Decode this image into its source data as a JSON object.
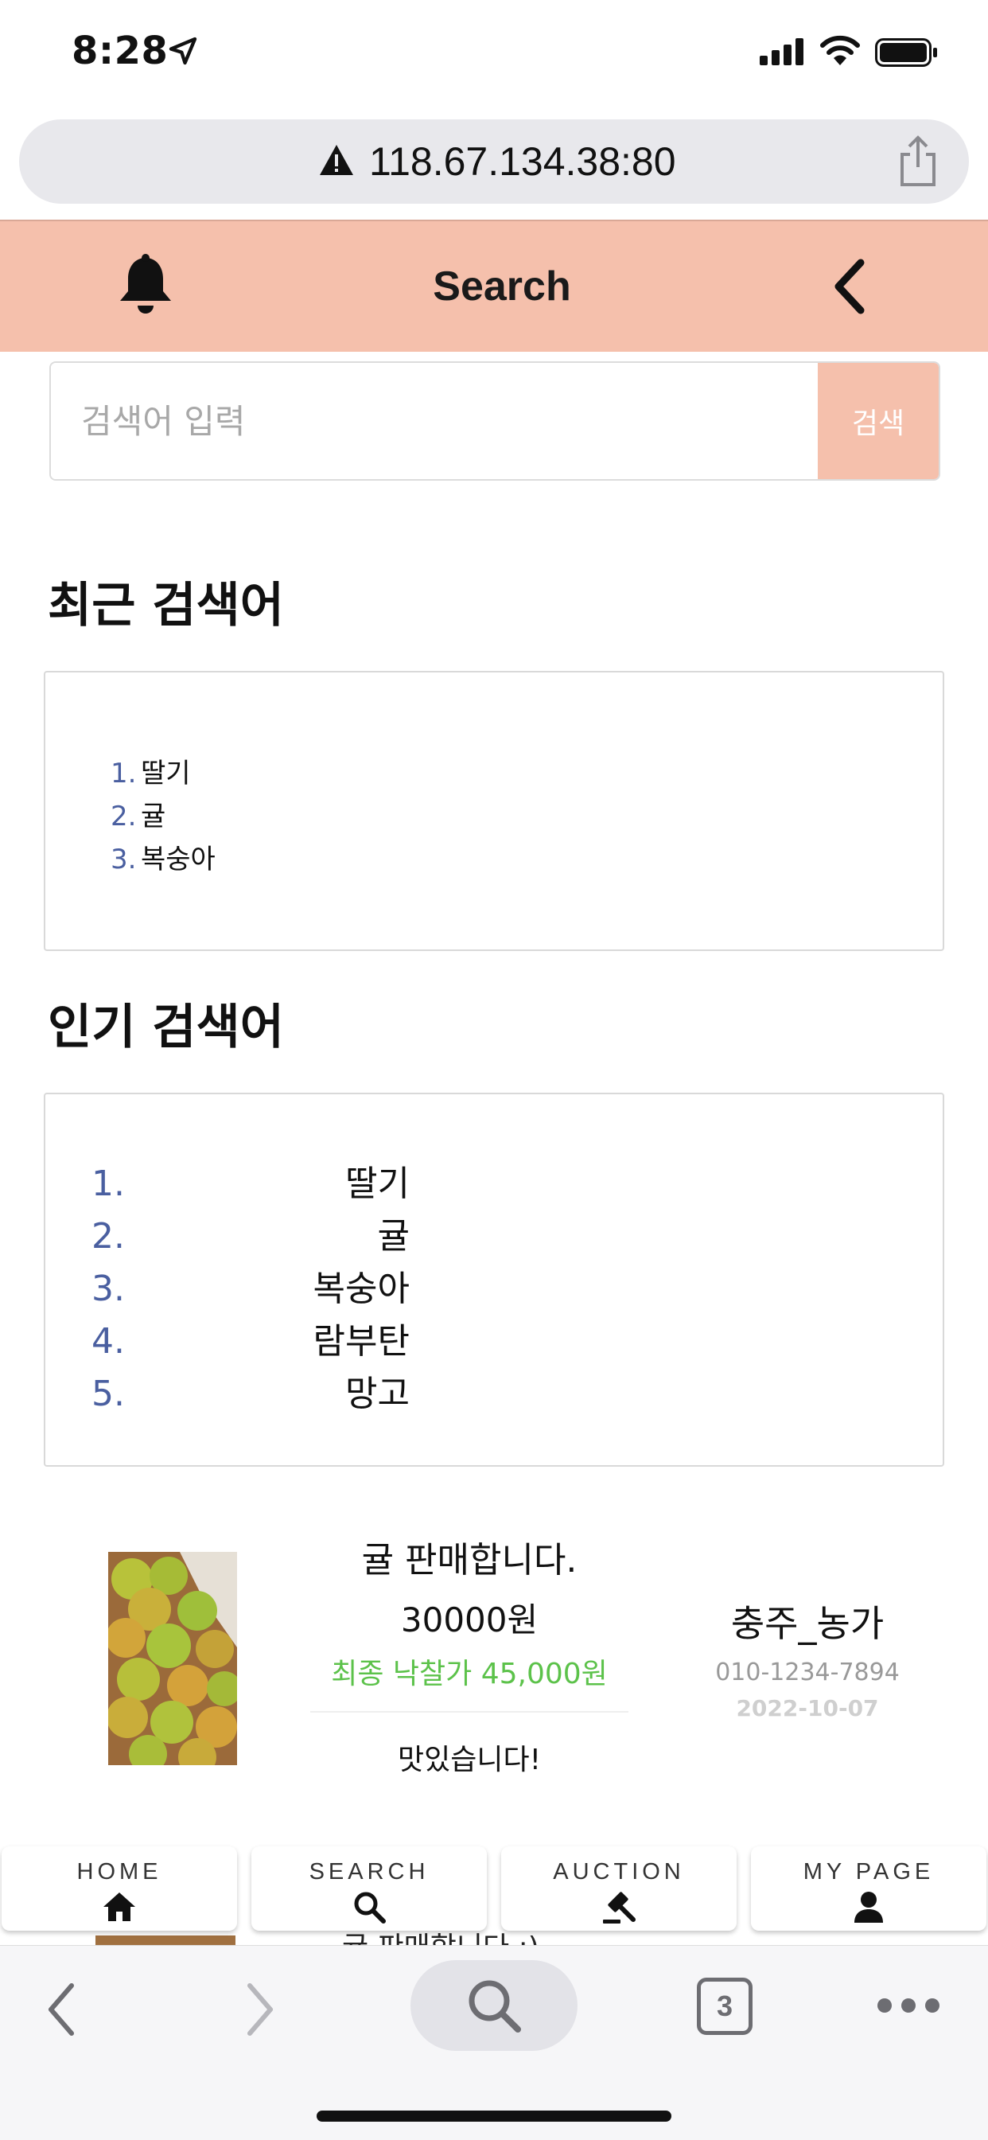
{
  "status_bar": {
    "time": "8:28"
  },
  "browser": {
    "url": "118.67.134.38:80",
    "tab_count": "3"
  },
  "header": {
    "title": "Search"
  },
  "search": {
    "placeholder": "검색어 입력",
    "button_label": "검색"
  },
  "recent": {
    "title": "최근 검색어",
    "items": [
      {
        "num": "1.",
        "label": "딸기"
      },
      {
        "num": "2.",
        "label": "귤"
      },
      {
        "num": "3.",
        "label": "복숭아"
      }
    ]
  },
  "popular": {
    "title": "인기 검색어",
    "items": [
      {
        "num": "1.",
        "label": "딸기"
      },
      {
        "num": "2.",
        "label": "귤"
      },
      {
        "num": "3.",
        "label": "복숭아"
      },
      {
        "num": "4.",
        "label": "람부탄"
      },
      {
        "num": "5.",
        "label": "망고"
      }
    ]
  },
  "product": {
    "name": "귤 판매합니다.",
    "price": "30000원",
    "final_bid": "최종 낙찰가 45,000원",
    "comment": "맛있습니다!",
    "seller": "충주_농가",
    "phone": "010-1234-7894",
    "date": "2022-10-07"
  },
  "next_product_peek": {
    "name": "귤 판매합니다 :)"
  },
  "tabs": [
    {
      "label": "HOME",
      "icon": "home-icon"
    },
    {
      "label": "SEARCH",
      "icon": "search-icon"
    },
    {
      "label": "AUCTION",
      "icon": "gavel-icon"
    },
    {
      "label": "MY PAGE",
      "icon": "user-icon"
    }
  ],
  "colors": {
    "accent": "#f5c0ac",
    "final_bid": "#5cc24a",
    "list_number": "#4a5fa0"
  }
}
